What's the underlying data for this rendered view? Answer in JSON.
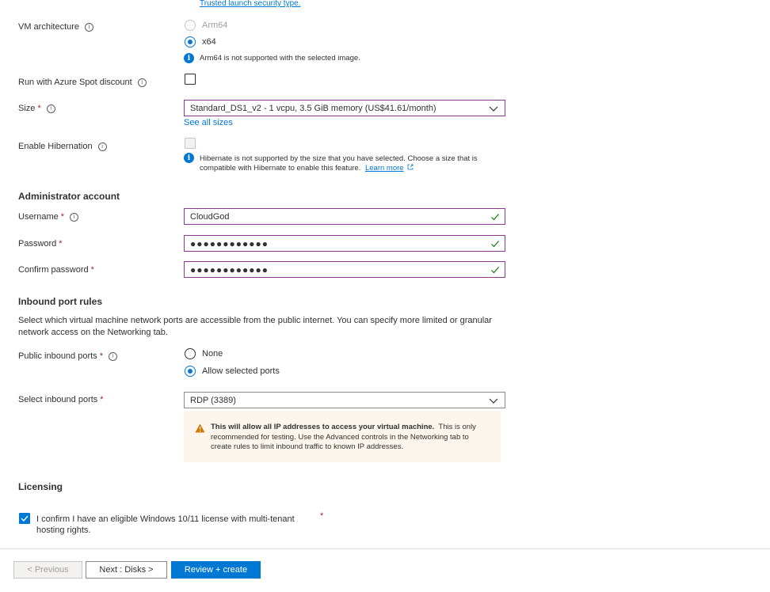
{
  "top_link": "Trusted launch security type.",
  "vm_arch": {
    "label": "VM architecture",
    "options": [
      "Arm64",
      "x64"
    ],
    "note": "Arm64 is not supported with the selected image."
  },
  "spot": {
    "label": "Run with Azure Spot discount"
  },
  "size": {
    "label": "Size",
    "value": "Standard_DS1_v2 - 1 vcpu, 3.5 GiB memory (US$41.61/month)",
    "see_all": "See all sizes"
  },
  "hibernation": {
    "label": "Enable Hibernation",
    "note_line1": "Hibernate is not supported by the size that you have selected. Choose a size that is",
    "note_line2": "compatible with Hibernate to enable this feature.",
    "learn_more": "Learn more"
  },
  "admin": {
    "heading": "Administrator account",
    "username_label": "Username",
    "username_value": "CloudGod",
    "password_label": "Password",
    "password_value": "●●●●●●●●●●●●",
    "confirm_label": "Confirm password",
    "confirm_value": "●●●●●●●●●●●●"
  },
  "inbound": {
    "heading": "Inbound port rules",
    "desc_line1": "Select which virtual machine network ports are accessible from the public internet. You can specify more limited or granular",
    "desc_line2": "network access on the Networking tab.",
    "public_label": "Public inbound ports",
    "options": [
      "None",
      "Allow selected ports"
    ],
    "select_label": "Select inbound ports",
    "select_value": "RDP (3389)",
    "warning_bold": "This will allow all IP addresses to access your virtual machine.",
    "warning_rest1": "This is only",
    "warning_line2": "recommended for testing.  Use the Advanced controls in the Networking tab to",
    "warning_line3": "create rules to limit inbound traffic to known IP addresses."
  },
  "licensing": {
    "heading": "Licensing",
    "confirm_line1": "I confirm I have an eligible Windows 10/11 license with multi-tenant",
    "confirm_line2": "hosting rights."
  },
  "footer": {
    "previous": "< Previous",
    "next": "Next : Disks >",
    "review": "Review + create"
  },
  "colors": {
    "accent": "#0078d4",
    "input_border_focus": "#8a3b8f",
    "valid_check": "#107c10",
    "warning_bg": "#fdf6ed",
    "warning_icon": "#d47500",
    "required": "#a4262c"
  }
}
